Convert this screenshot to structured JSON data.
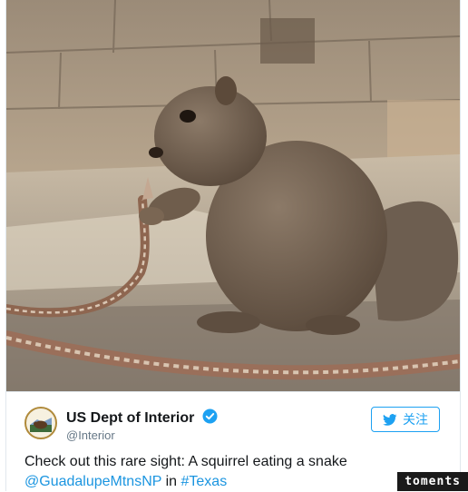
{
  "tweet": {
    "author_name": "US Dept of Interior",
    "handle": "@Interior",
    "follow_label": "关注",
    "text_plain": "Check out this rare sight: A squirrel eating a snake",
    "mention": "@GuadalupeMtnsNP",
    "in_word": "in",
    "hashtag": "#Texas",
    "media_description_icon": "squirrel-photo"
  },
  "colors": {
    "brand_blue": "#1da1f2",
    "link_blue": "#1b95e0",
    "text": "#14171a",
    "muted": "#657786"
  },
  "watermark": {
    "text": "toments"
  }
}
